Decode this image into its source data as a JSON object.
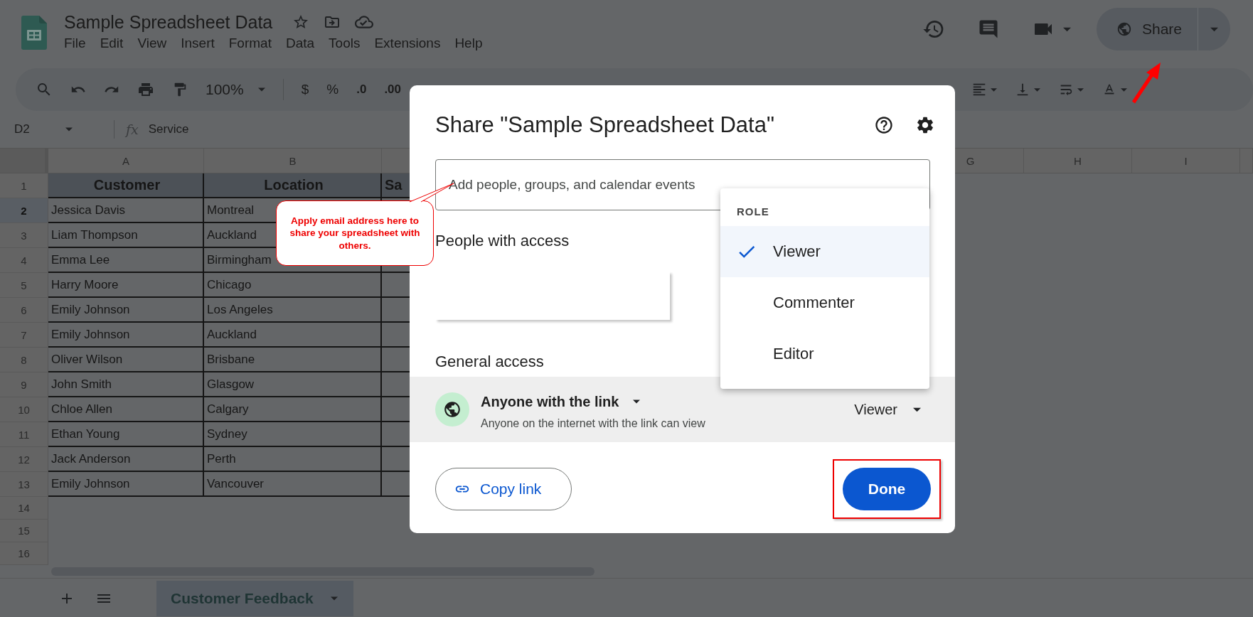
{
  "app_bar": {
    "title": "Sample Spreadsheet Data",
    "menu": [
      "File",
      "Edit",
      "View",
      "Insert",
      "Format",
      "Data",
      "Tools",
      "Extensions",
      "Help"
    ],
    "share_button": {
      "label": "Share"
    }
  },
  "toolbar": {
    "zoom": "100%",
    "currency": "$",
    "percent": "%",
    "decrease_decimal": ".0",
    "increase_decimal": ".00"
  },
  "formula_bar": {
    "cell_reference": "D2",
    "function_label": "fx",
    "value": "Service"
  },
  "grid": {
    "columns_left": [
      "A",
      "B"
    ],
    "columns_right": [
      "G",
      "H",
      "I"
    ],
    "header_row": [
      "Customer",
      "Location",
      "Sa"
    ],
    "rows": [
      [
        "Jessica Davis",
        "Montreal"
      ],
      [
        "Liam Thompson",
        "Auckland"
      ],
      [
        "Emma Lee",
        "Birmingham"
      ],
      [
        "Harry Moore",
        "Chicago"
      ],
      [
        "Emily Johnson",
        "Los Angeles"
      ],
      [
        "Emily Johnson",
        "Auckland"
      ],
      [
        "Oliver Wilson",
        "Brisbane"
      ],
      [
        "John Smith",
        "Glasgow"
      ],
      [
        "Chloe Allen",
        "Calgary"
      ],
      [
        "Ethan Young",
        "Sydney"
      ],
      [
        "Jack Anderson",
        "Perth"
      ],
      [
        "Emily Johnson",
        "Vancouver"
      ]
    ],
    "row_numbers": [
      {
        "label": "1",
        "selected": false
      },
      {
        "label": "2",
        "selected": true
      },
      {
        "label": "3",
        "selected": false
      },
      {
        "label": "4",
        "selected": false
      },
      {
        "label": "5",
        "selected": false
      },
      {
        "label": "6",
        "selected": false
      },
      {
        "label": "7",
        "selected": false
      },
      {
        "label": "8",
        "selected": false
      },
      {
        "label": "9",
        "selected": false
      },
      {
        "label": "10",
        "selected": false
      },
      {
        "label": "11",
        "selected": false
      },
      {
        "label": "12",
        "selected": false
      },
      {
        "label": "13",
        "selected": false
      },
      {
        "label": "14",
        "selected": false
      },
      {
        "label": "15",
        "selected": false
      },
      {
        "label": "16",
        "selected": false
      }
    ]
  },
  "sheet_tabs": [
    {
      "label": "Customer Feedback",
      "selected": true
    }
  ],
  "share_dialog": {
    "title": "Share \"Sample Spreadsheet Data\"",
    "add_field": {
      "placeholder": "Add people, groups, and calendar events"
    },
    "people_heading": "People with access",
    "general_heading": "General access",
    "access": {
      "scope": "Anyone with the link",
      "description": "Anyone on the internet with the link can view",
      "role": "Viewer"
    },
    "role_menu": {
      "heading": "ROLE",
      "options": [
        {
          "label": "Viewer",
          "selected": true
        },
        {
          "label": "Commenter",
          "selected": false
        },
        {
          "label": "Editor",
          "selected": false
        }
      ]
    },
    "copy_link": "Copy link",
    "done": "Done"
  },
  "annotations": {
    "callout": "Apply email address here to share your spreadsheet with others."
  }
}
